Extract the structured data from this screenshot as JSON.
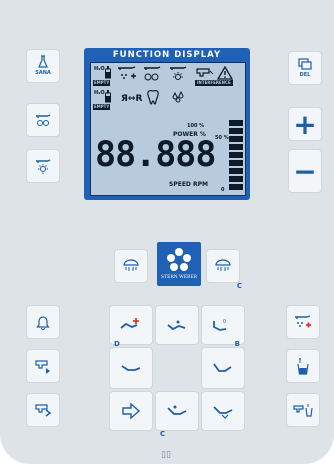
{
  "display": {
    "title": "FUNCTION DISPLAY",
    "lcd": {
      "h2o_1": "H₂O",
      "h2o_2": "H₂O",
      "empty_1": "EMPTY",
      "empty_2": "EMPTY",
      "interference": "INTERFERENCE",
      "pct_100": "100 %",
      "pct_50": "50 %",
      "pct_0": "0",
      "power": "POWER  %",
      "digits": "88.888",
      "speed": "SPEED  RPM",
      "bar_level": 1.0
    }
  },
  "buttons": {
    "sana_label": "SANA",
    "del_label": "DEL",
    "plus": "+",
    "minus": "−",
    "brand": "STERN WEBER",
    "c_tag_1": "C",
    "c_tag_2": "C",
    "d_tag": "D",
    "b_tag": "B",
    "book": "▯▯"
  },
  "colors": {
    "panel": "#dde3e7",
    "display_blue": "#1f62b5",
    "lcd_bg": "#b8cbdc",
    "icon_blue": "#1f5fa8",
    "accent_red": "#e02020"
  }
}
